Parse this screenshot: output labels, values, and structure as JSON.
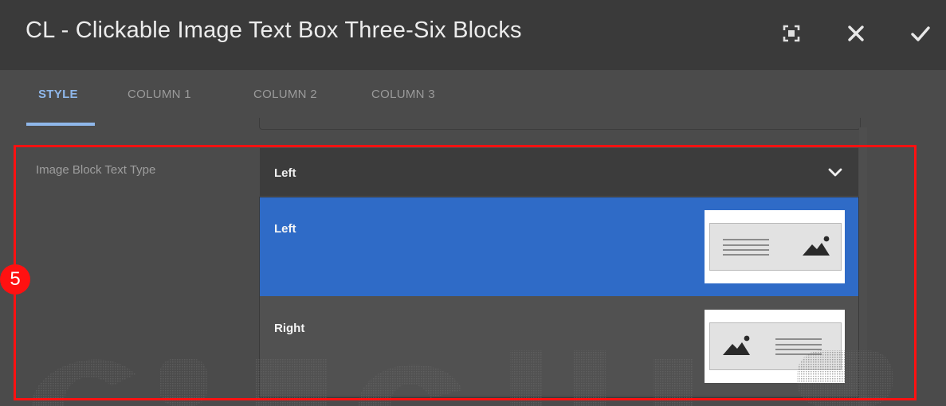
{
  "dialog": {
    "title": "CL - Clickable Image Text Box Three-Six Blocks",
    "buttons": {
      "fullscreen_icon": "fullscreen-icon",
      "close_icon": "close-icon",
      "confirm_icon": "check-icon"
    }
  },
  "tabs": [
    {
      "label": "STYLE",
      "active": true
    },
    {
      "label": "COLUMN 1",
      "active": false
    },
    {
      "label": "COLUMN 2",
      "active": false
    },
    {
      "label": "COLUMN 3",
      "active": false
    }
  ],
  "field": {
    "label": "Image Block Text Type",
    "selected_value": "Left",
    "options": [
      {
        "label": "Left",
        "selected": true,
        "thumbnail": "text-left-image-right"
      },
      {
        "label": "Right",
        "selected": false,
        "thumbnail": "image-left-text-right"
      }
    ]
  },
  "annotation": {
    "step_number": "5",
    "highlight_color": "#ff1111"
  },
  "colors": {
    "accent": "#8fb7ea",
    "selected_option": "#2f6bc7",
    "header_bg": "#3a3a3a",
    "panel_bg": "#4b4b4b"
  }
}
